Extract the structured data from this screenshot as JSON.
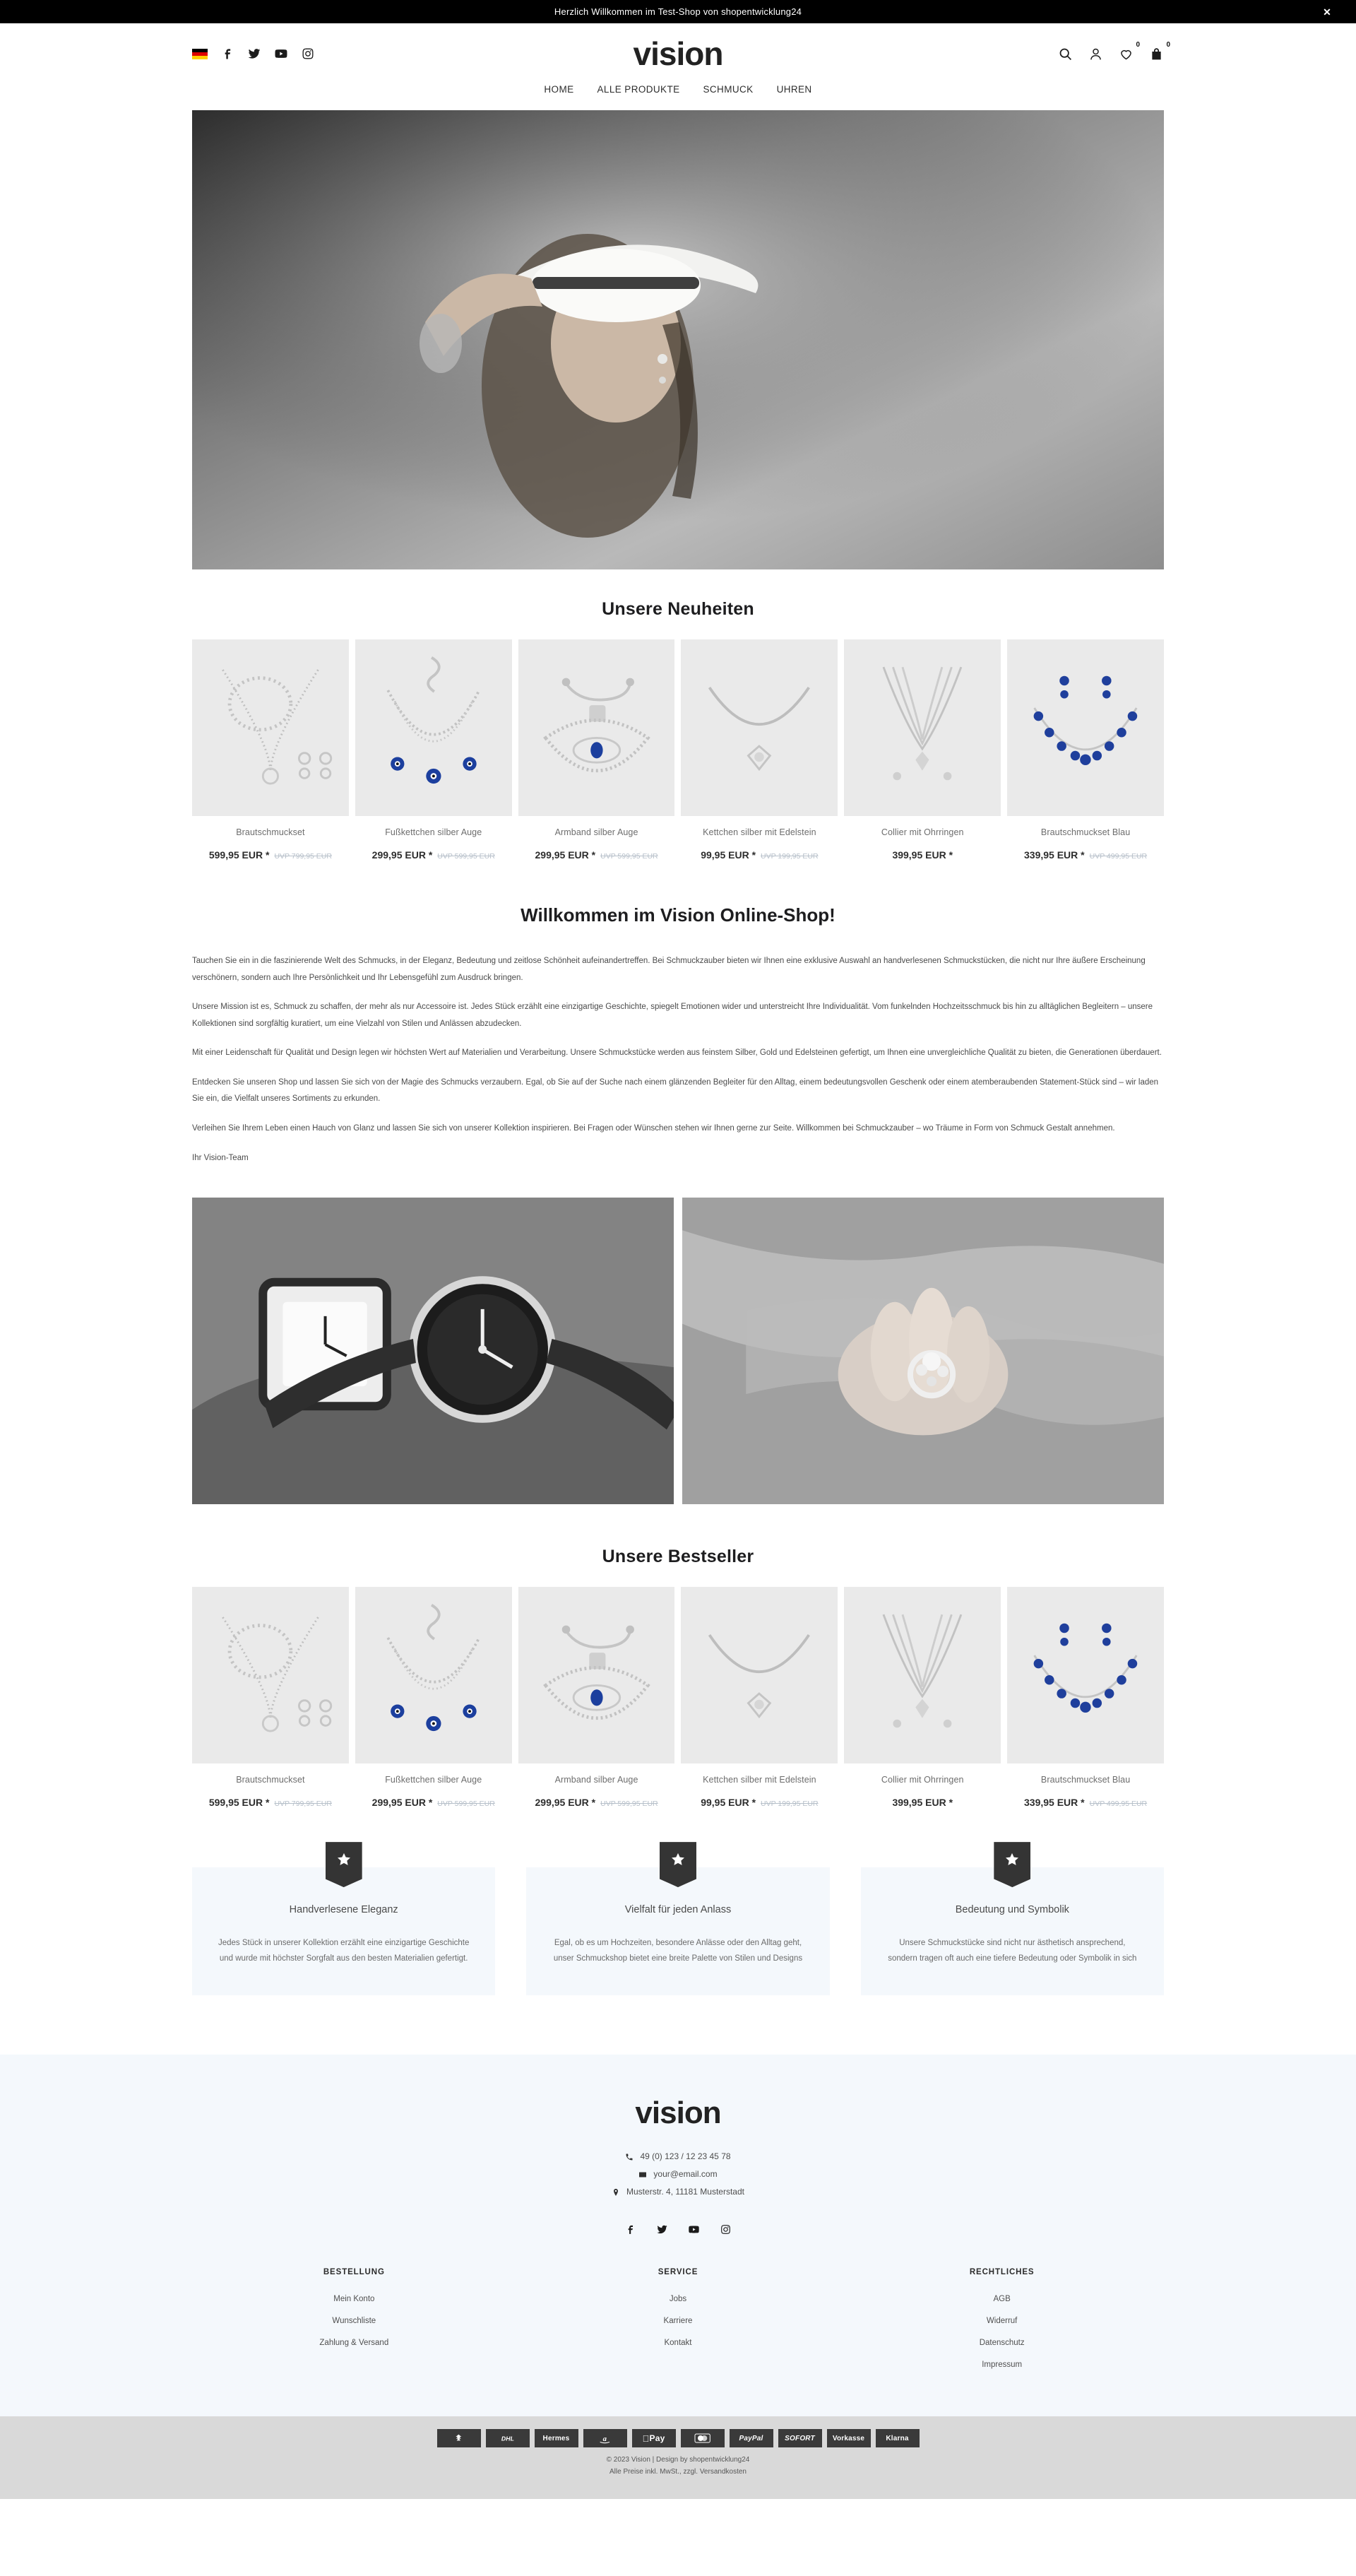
{
  "promo": {
    "message": "Herzlich Willkommen im Test-Shop von shopentwicklung24",
    "close_label": "✕"
  },
  "header": {
    "logo": "vision",
    "language_flag": "german-flag",
    "social": [
      {
        "name": "facebook",
        "label": "Facebook"
      },
      {
        "name": "twitter",
        "label": "Twitter"
      },
      {
        "name": "youtube",
        "label": "YouTube"
      },
      {
        "name": "instagram",
        "label": "Instagram"
      }
    ],
    "actions": {
      "search": "search-icon",
      "account": "account-icon",
      "wishlist_count": "0",
      "cart_count": "0"
    }
  },
  "nav": {
    "items": [
      {
        "label": "HOME"
      },
      {
        "label": "ALLE PRODUKTE"
      },
      {
        "label": "SCHMUCK"
      },
      {
        "label": "UHREN"
      }
    ]
  },
  "sections": {
    "neuheiten_title": "Unsere Neuheiten",
    "bestseller_title": "Unsere Bestseller",
    "welcome_title": "Willkommen im Vision Online-Shop!"
  },
  "products": [
    {
      "name": "Brautschmuckset",
      "price": "599,95 EUR *",
      "uvp": "UVP 799,95 EUR",
      "image": "bridal-jewelry-set"
    },
    {
      "name": "Fußkettchen silber Auge",
      "price": "299,95 EUR *",
      "uvp": "UVP 599,95 EUR",
      "image": "silver-anklet-evil-eye"
    },
    {
      "name": "Armband silber Auge",
      "price": "299,95 EUR *",
      "uvp": "UVP 599,95 EUR",
      "image": "silver-bracelet-evil-eye"
    },
    {
      "name": "Kettchen silber mit Edelstein",
      "price": "99,95 EUR *",
      "uvp": "UVP 199,95 EUR",
      "image": "silver-necklace-gemstone"
    },
    {
      "name": "Collier mit Ohrringen",
      "price": "399,95 EUR *",
      "uvp": "",
      "image": "collier-with-earrings"
    },
    {
      "name": "Brautschmuckset Blau",
      "price": "339,95 EUR *",
      "uvp": "UVP 499,95 EUR",
      "image": "bridal-jewelry-set-blue"
    }
  ],
  "welcome_paragraphs": [
    "Tauchen Sie ein in die faszinierende Welt des Schmucks, in der Eleganz, Bedeutung und zeitlose Schönheit aufeinandertreffen. Bei Schmuckzauber bieten wir Ihnen eine exklusive Auswahl an handverlesenen Schmuckstücken, die nicht nur Ihre äußere Erscheinung verschönern, sondern auch Ihre Persönlichkeit und Ihr Lebensgefühl zum Ausdruck bringen.",
    "Unsere Mission ist es, Schmuck zu schaffen, der mehr als nur Accessoire ist. Jedes Stück erzählt eine einzigartige Geschichte, spiegelt Emotionen wider und unterstreicht Ihre Individualität. Vom funkelnden Hochzeitsschmuck bis hin zu alltäglichen Begleitern – unsere Kollektionen sind sorgfältig kuratiert, um eine Vielzahl von Stilen und Anlässen abzudecken.",
    "Mit einer Leidenschaft für Qualität und Design legen wir höchsten Wert auf Materialien und Verarbeitung. Unsere Schmuckstücke werden aus feinstem Silber, Gold und Edelsteinen gefertigt, um Ihnen eine unvergleichliche Qualität zu bieten, die Generationen überdauert.",
    "Entdecken Sie unseren Shop und lassen Sie sich von der Magie des Schmucks verzaubern. Egal, ob Sie auf der Suche nach einem glänzenden Begleiter für den Alltag, einem bedeutungsvollen Geschenk oder einem atemberaubenden Statement-Stück sind – wir laden Sie ein, die Vielfalt unseres Sortiments zu erkunden.",
    "Verleihen Sie Ihrem Leben einen Hauch von Glanz und lassen Sie sich von unserer Kollektion inspirieren. Bei Fragen oder Wünschen stehen wir Ihnen gerne zur Seite. Willkommen bei Schmuckzauber – wo Träume in Form von Schmuck Gestalt annehmen.",
    "Ihr Vision-Team"
  ],
  "banners": [
    {
      "image": "watches-black-white"
    },
    {
      "image": "hand-with-ring"
    }
  ],
  "features": [
    {
      "icon": "star-icon",
      "title": "Handverlesene Eleganz",
      "text": "Jedes Stück in unserer Kollektion erzählt eine einzigartige Geschichte und wurde mit höchster Sorgfalt aus den besten Materialien gefertigt."
    },
    {
      "icon": "star-icon",
      "title": "Vielfalt für jeden Anlass",
      "text": "Egal, ob es um Hochzeiten, besondere Anlässe oder den Alltag geht, unser Schmuckshop bietet eine breite Palette von Stilen und Designs"
    },
    {
      "icon": "star-icon",
      "title": "Bedeutung und Symbolik",
      "text": "Unsere Schmuckstücke sind nicht nur ästhetisch ansprechend, sondern tragen oft auch eine tiefere Bedeutung oder Symbolik in sich"
    }
  ],
  "footer": {
    "logo": "vision",
    "phone": "49 (0) 123 / 12 23 45 78",
    "email": "your@email.com",
    "address": "Musterstr. 4, 11181 Musterstadt",
    "social": [
      {
        "name": "facebook",
        "label": "Facebook"
      },
      {
        "name": "twitter",
        "label": "Twitter"
      },
      {
        "name": "youtube",
        "label": "YouTube"
      },
      {
        "name": "instagram",
        "label": "Instagram"
      }
    ],
    "columns": [
      {
        "title": "BESTELLUNG",
        "links": [
          "Mein Konto",
          "Wunschliste",
          "Zahlung & Versand"
        ]
      },
      {
        "title": "SERVICE",
        "links": [
          "Jobs",
          "Karriere",
          "Kontakt"
        ]
      },
      {
        "title": "RECHTLICHES",
        "links": [
          "AGB",
          "Widerruf",
          "Datenschutz",
          "Impressum"
        ]
      }
    ],
    "payments": [
      {
        "name": "deutsche-post",
        "label": "POST"
      },
      {
        "name": "dhl",
        "label": "DHL"
      },
      {
        "name": "hermes",
        "label": "Hermes"
      },
      {
        "name": "amazon-pay",
        "label": "a"
      },
      {
        "name": "apple-pay",
        "label": "Pay"
      },
      {
        "name": "mastercard",
        "label": "MC"
      },
      {
        "name": "paypal",
        "label": "PayPal"
      },
      {
        "name": "sofort",
        "label": "SOFORT"
      },
      {
        "name": "vorkasse",
        "label": "Vorkasse"
      },
      {
        "name": "klarna",
        "label": "Klarna"
      }
    ],
    "copyright_line1": "© 2023 Vision | Design by shopentwicklung24",
    "copyright_line2": "Alle Preise inkl. MwSt., zzgl. Versandkosten"
  },
  "colors": {
    "accent_dark": "#343434",
    "feature_bg": "#f4f8fc",
    "price": "#2d2d2d",
    "uvp": "#b6bfc9"
  }
}
